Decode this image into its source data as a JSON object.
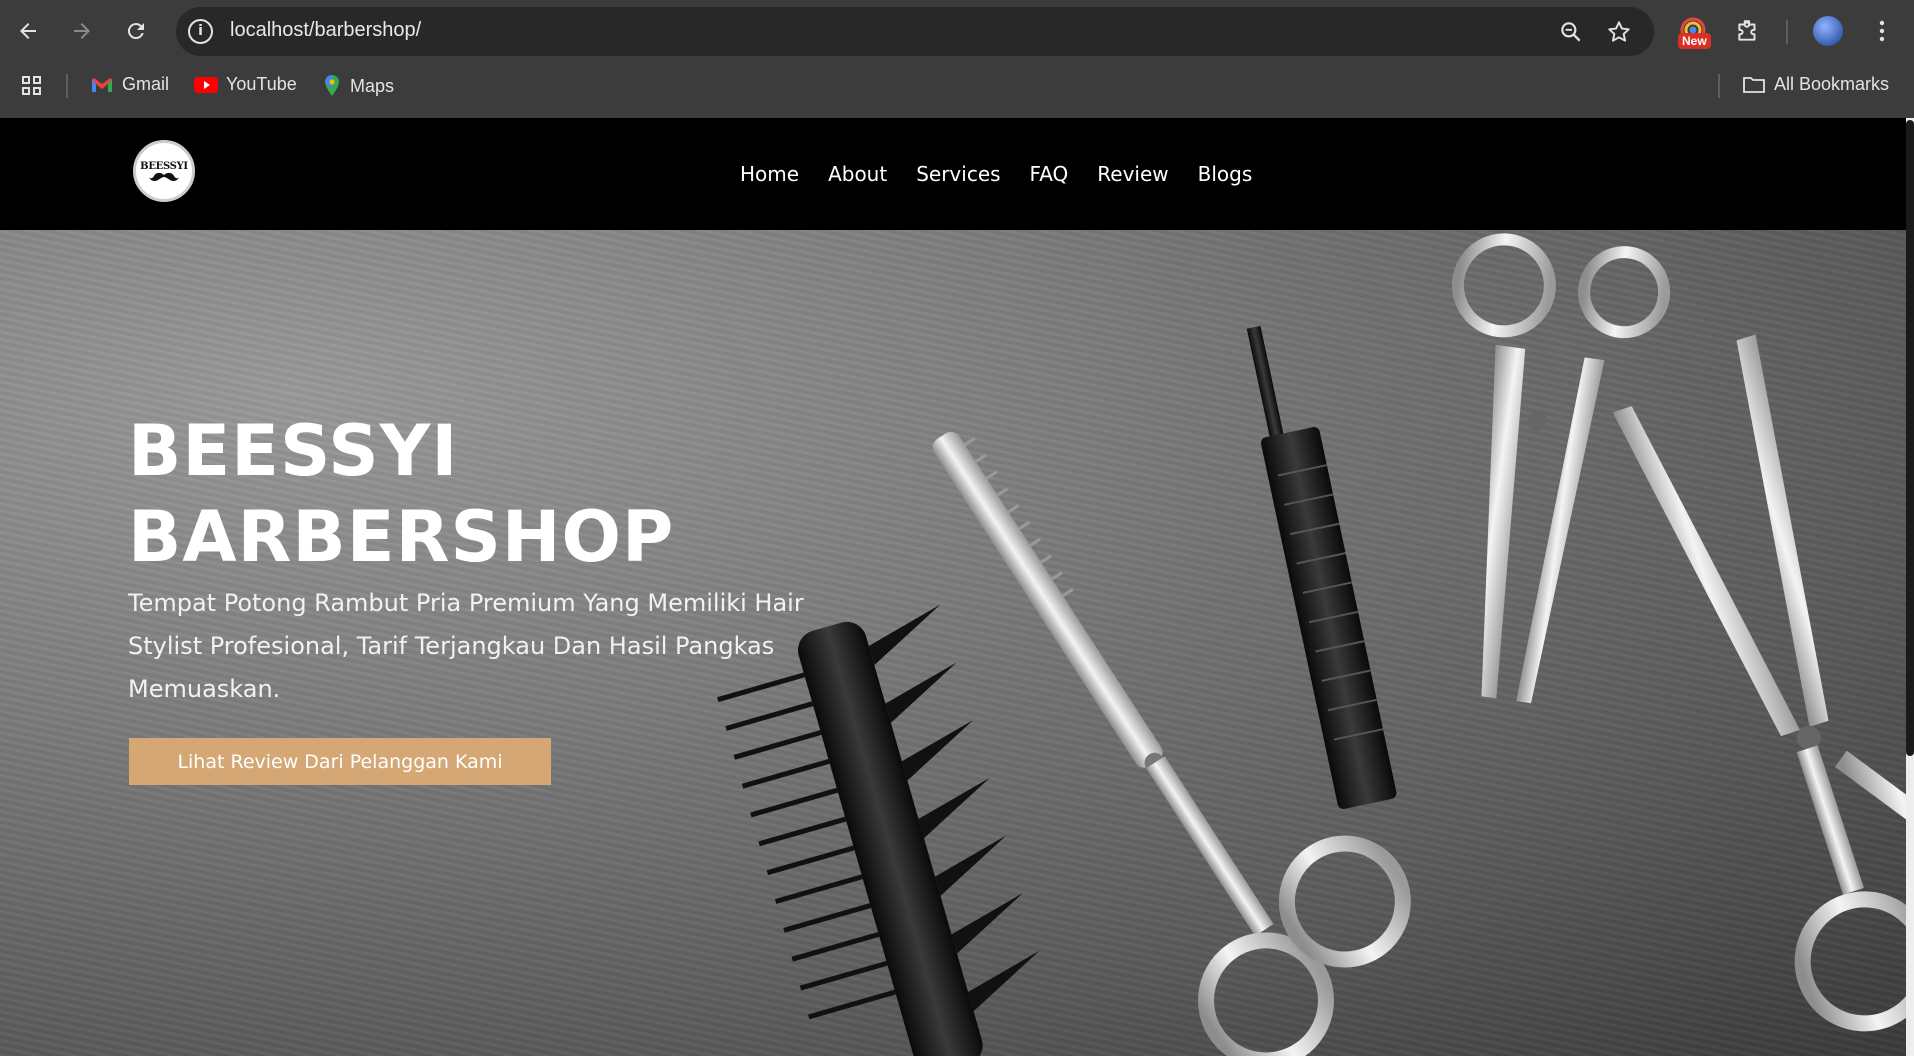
{
  "browser": {
    "url": "localhost/barbershop/",
    "new_badge": "New",
    "bookmarks": [
      {
        "label": "Gmail"
      },
      {
        "label": "YouTube"
      },
      {
        "label": "Maps"
      }
    ],
    "all_bookmarks": "All Bookmarks"
  },
  "site": {
    "logo_text": "BEESSYI",
    "nav": [
      "Home",
      "About",
      "Services",
      "FAQ",
      "Review",
      "Blogs"
    ]
  },
  "hero": {
    "title_line1": "BEESSYI",
    "title_line2": "BARBERSHOP",
    "subtitle": "Tempat Potong Rambut Pria Premium Yang Memiliki Hair Stylist Profesional, Tarif Terjangkau Dan Hasil Pangkas Memuaskan.",
    "cta": "Lihat Review Dari Pelanggan Kami"
  },
  "colors": {
    "cta_bg": "#d4a774",
    "header_bg": "#000000",
    "chrome_bg": "#3c3c3c"
  }
}
